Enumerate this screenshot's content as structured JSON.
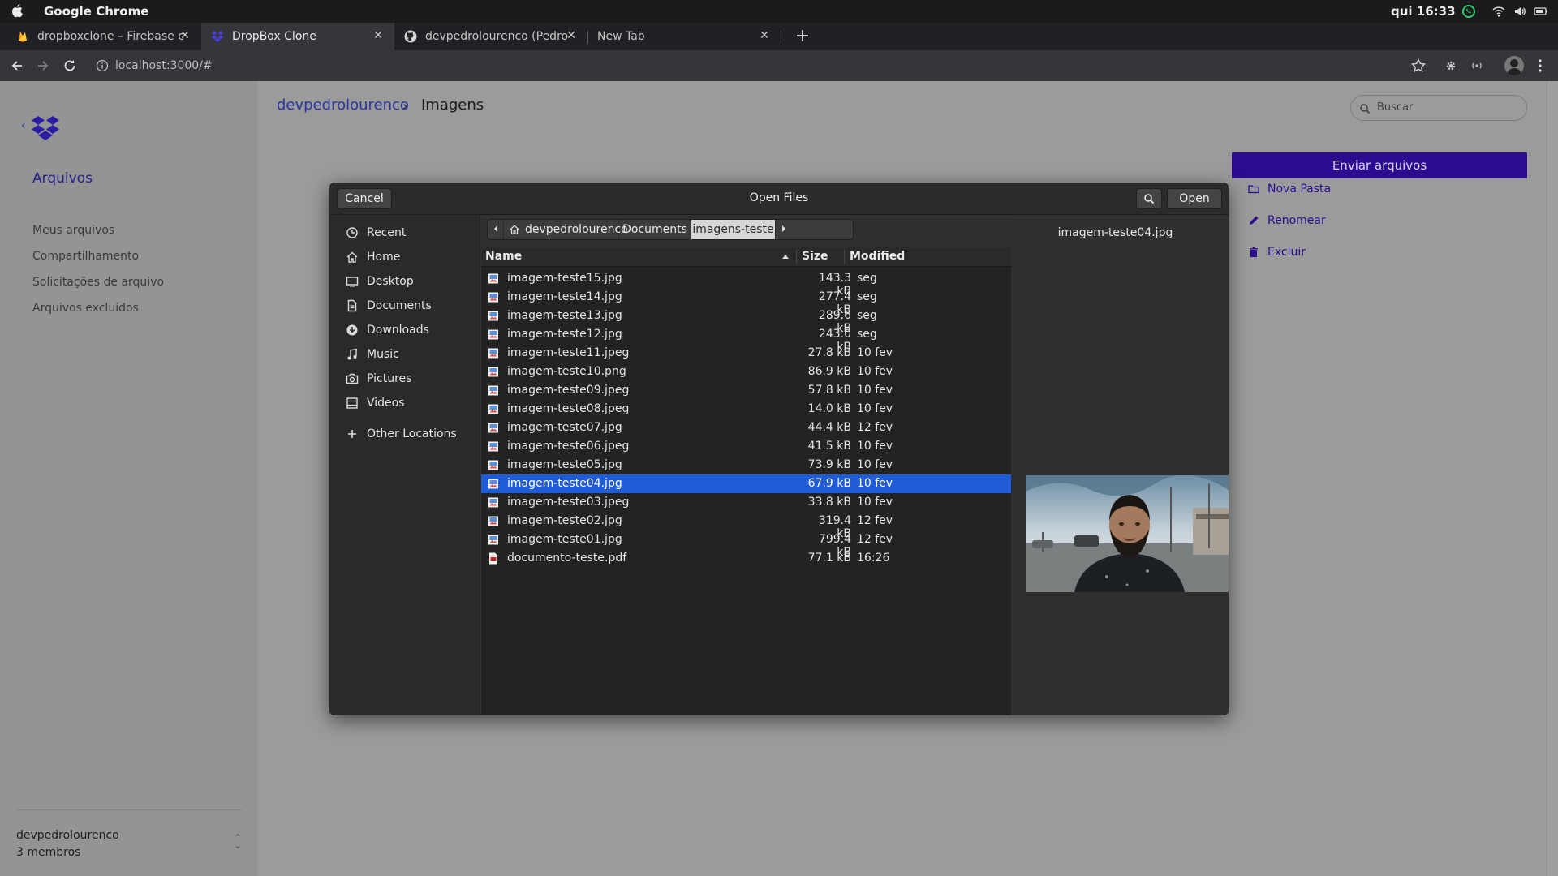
{
  "system": {
    "app_name": "Google Chrome",
    "clock": "qui 16:33"
  },
  "browser": {
    "tabs": [
      {
        "title": "dropboxclone – Firebase c",
        "icon": "firebase-icon",
        "active": false
      },
      {
        "title": "DropBox Clone",
        "icon": "dropbox-icon",
        "active": true
      },
      {
        "title": "devpedrolourenco (Pedro",
        "icon": "github-icon",
        "active": false
      },
      {
        "title": "New Tab",
        "icon": "",
        "active": false
      }
    ],
    "url": "localhost:3000/#"
  },
  "app": {
    "sidebar": {
      "section_title": "Arquivos",
      "items": [
        "Meus arquivos",
        "Compartilhamento",
        "Solicitações de arquivo",
        "Arquivos excluídos"
      ],
      "team_name": "devpedrolourenco",
      "members": "3 membros"
    },
    "breadcrumb": {
      "root": "devpedrolourenco",
      "current": "Imagens"
    },
    "search_placeholder": "Buscar",
    "upload_label": "Enviar arquivos",
    "actions": [
      {
        "label": "Nova Pasta",
        "icon": "folder-icon"
      },
      {
        "label": "Renomear",
        "icon": "pencil-icon"
      },
      {
        "label": "Excluir",
        "icon": "trash-icon"
      }
    ],
    "accent_color": "#2b0c8f"
  },
  "dialog": {
    "title": "Open Files",
    "cancel_label": "Cancel",
    "open_label": "Open",
    "places": [
      {
        "label": "Recent",
        "icon": "clock-icon"
      },
      {
        "label": "Home",
        "icon": "home-icon"
      },
      {
        "label": "Desktop",
        "icon": "desktop-icon"
      },
      {
        "label": "Documents",
        "icon": "document-icon"
      },
      {
        "label": "Downloads",
        "icon": "download-icon"
      },
      {
        "label": "Music",
        "icon": "music-icon"
      },
      {
        "label": "Pictures",
        "icon": "camera-icon"
      },
      {
        "label": "Videos",
        "icon": "video-icon"
      },
      {
        "label": "Other Locations",
        "icon": "plus-icon"
      }
    ],
    "path": [
      "devpedrolourenco",
      "Documents",
      "imagens-teste"
    ],
    "columns": {
      "name": "Name",
      "size": "Size",
      "modified": "Modified"
    },
    "files": [
      {
        "name": "imagem-teste15.jpg",
        "size": "143.3 kB",
        "modified": "seg",
        "type": "image"
      },
      {
        "name": "imagem-teste14.jpg",
        "size": "277.4 kB",
        "modified": "seg",
        "type": "image"
      },
      {
        "name": "imagem-teste13.jpg",
        "size": "289.6 kB",
        "modified": "seg",
        "type": "image"
      },
      {
        "name": "imagem-teste12.jpg",
        "size": "243.0 kB",
        "modified": "seg",
        "type": "image"
      },
      {
        "name": "imagem-teste11.jpeg",
        "size": "27.8 kB",
        "modified": "10 fev",
        "type": "image"
      },
      {
        "name": "imagem-teste10.png",
        "size": "86.9 kB",
        "modified": "10 fev",
        "type": "image"
      },
      {
        "name": "imagem-teste09.jpeg",
        "size": "57.8 kB",
        "modified": "10 fev",
        "type": "image"
      },
      {
        "name": "imagem-teste08.jpeg",
        "size": "14.0 kB",
        "modified": "10 fev",
        "type": "image"
      },
      {
        "name": "imagem-teste07.jpg",
        "size": "44.4 kB",
        "modified": "12 fev",
        "type": "image"
      },
      {
        "name": "imagem-teste06.jpeg",
        "size": "41.5 kB",
        "modified": "10 fev",
        "type": "image"
      },
      {
        "name": "imagem-teste05.jpg",
        "size": "73.9 kB",
        "modified": "10 fev",
        "type": "image"
      },
      {
        "name": "imagem-teste04.jpg",
        "size": "67.9 kB",
        "modified": "10 fev",
        "type": "image",
        "selected": true
      },
      {
        "name": "imagem-teste03.jpeg",
        "size": "33.8 kB",
        "modified": "10 fev",
        "type": "image"
      },
      {
        "name": "imagem-teste02.jpg",
        "size": "319.4 kB",
        "modified": "12 fev",
        "type": "image"
      },
      {
        "name": "imagem-teste01.jpg",
        "size": "799.4 kB",
        "modified": "12 fev",
        "type": "image"
      },
      {
        "name": "documento-teste.pdf",
        "size": "77.1 kB",
        "modified": "16:26",
        "type": "pdf"
      }
    ],
    "preview_name": "imagem-teste04.jpg",
    "selection_color": "#1f5cd6"
  }
}
